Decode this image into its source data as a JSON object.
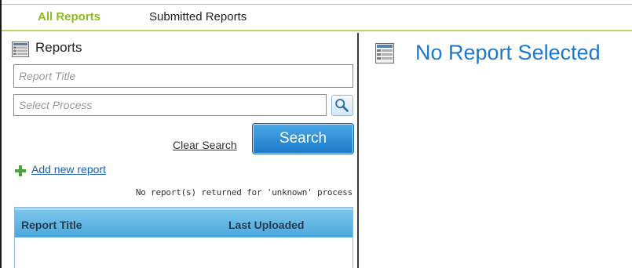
{
  "tabs": [
    {
      "label": "All Reports",
      "active": true
    },
    {
      "label": "Submitted Reports",
      "active": false
    }
  ],
  "left": {
    "title": "Reports",
    "report_title_placeholder": "Report Title",
    "process_placeholder": "Select Process",
    "clear_label": "Clear Search",
    "search_label": "Search",
    "add_label": "Add new report",
    "status": "No report(s) returned for 'unknown' process",
    "grid": {
      "columns": [
        "Report Title",
        "Last Uploaded"
      ]
    }
  },
  "right": {
    "title": "No Report Selected"
  },
  "icons": {
    "panel": "report-icon",
    "lookup": "magnifier-icon",
    "add": "plus-icon"
  },
  "colors": {
    "accent_green": "#8bbd1f",
    "tab_border": "#b9d36a",
    "link_blue": "#1a5fb4",
    "button_blue": "#1a78c8",
    "title_blue": "#1f77c9",
    "grid_header": "#4aa7db"
  }
}
